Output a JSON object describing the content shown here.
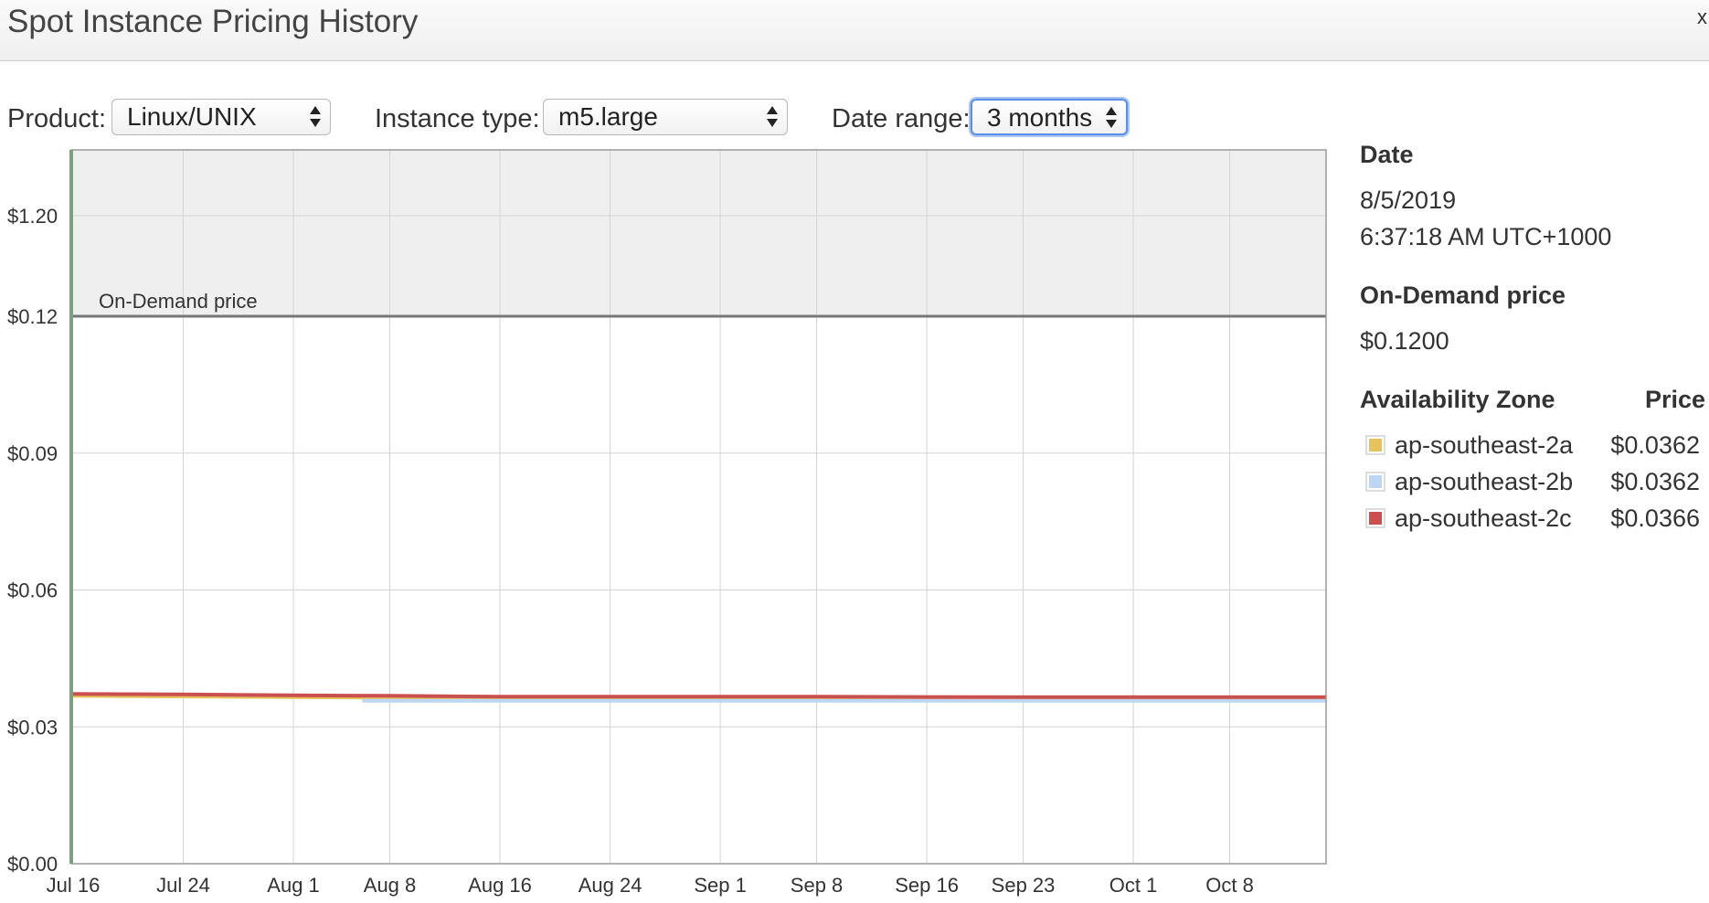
{
  "header": {
    "title": "Spot Instance Pricing History",
    "close_label": "x"
  },
  "controls": {
    "product_label": "Product:",
    "product_value": "Linux/UNIX",
    "instance_label": "Instance type:",
    "instance_value": "m5.large",
    "range_label": "Date range:",
    "range_value": "3 months"
  },
  "panel": {
    "date_heading": "Date",
    "date_value": "8/5/2019",
    "time_value": "6:37:18 AM UTC+1000",
    "ondemand_heading": "On-Demand price",
    "ondemand_value": "$0.1200",
    "zone_heading": "Availability Zone",
    "price_heading": "Price",
    "zones": [
      {
        "name": "ap-southeast-2a",
        "price": "$0.0362",
        "color": "#e6c35c"
      },
      {
        "name": "ap-southeast-2b",
        "price": "$0.0362",
        "color": "#bcd6f4"
      },
      {
        "name": "ap-southeast-2c",
        "price": "$0.0366",
        "color": "#c9504e"
      }
    ]
  },
  "chart_data": {
    "type": "line",
    "x_ticks": [
      "Jul 16",
      "Jul 24",
      "Aug 1",
      "Aug 8",
      "Aug 16",
      "Aug 24",
      "Sep 1",
      "Sep 8",
      "Sep 16",
      "Sep 23",
      "Oct 1",
      "Oct 8"
    ],
    "xlim": [
      "2019-07-16",
      "2019-10-15"
    ],
    "y_ticks": [
      "$0.00",
      "$0.03",
      "$0.06",
      "$0.09",
      "$0.12",
      "$1.20"
    ],
    "y_tick_values": [
      0,
      0.03,
      0.06,
      0.09,
      0.12,
      1.2
    ],
    "on_demand_label": "On-Demand price",
    "on_demand_price": 0.12,
    "grid": true,
    "series": [
      {
        "name": "ap-southeast-2a",
        "color": "#e6c35c",
        "points": [
          [
            "2019-07-16",
            0.0368
          ],
          [
            "2019-08-07",
            0.0364
          ],
          [
            "2019-08-08",
            0.0363
          ],
          [
            "2019-10-15",
            0.0362
          ]
        ]
      },
      {
        "name": "ap-southeast-2b",
        "color": "#bcd6f4",
        "points": [
          [
            "2019-08-06",
            0.0357
          ],
          [
            "2019-10-15",
            0.0357
          ]
        ]
      },
      {
        "name": "ap-southeast-2c",
        "color": "#c9504e",
        "points": [
          [
            "2019-07-16",
            0.0372
          ],
          [
            "2019-07-24",
            0.0371
          ],
          [
            "2019-08-01",
            0.0369
          ],
          [
            "2019-08-08",
            0.0368
          ],
          [
            "2019-08-16",
            0.0366
          ],
          [
            "2019-09-08",
            0.0366
          ],
          [
            "2019-09-23",
            0.0365
          ],
          [
            "2019-10-15",
            0.0365
          ]
        ]
      }
    ]
  }
}
